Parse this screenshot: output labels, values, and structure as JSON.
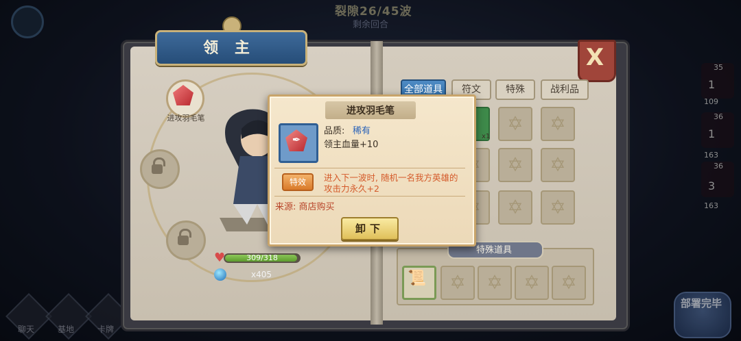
{
  "hud": {
    "wave": "裂隙26/45波",
    "sub": "剩余回合",
    "bottom_buttons": [
      "聊天",
      "基地",
      "卡牌"
    ],
    "deploy_label": "部署完毕",
    "side_numbers": [
      "35",
      "36",
      "36",
      "109",
      "163",
      "163",
      "1",
      "1",
      "3"
    ]
  },
  "panel": {
    "title": "领 主",
    "close_label": "X",
    "slot_label": "进攻羽毛笔",
    "hp": {
      "current": 309,
      "max": 318,
      "text": "309/318"
    },
    "gold": "x405",
    "tabs": [
      {
        "label": "全部道具",
        "active": true
      },
      {
        "label": "符文",
        "active": false
      },
      {
        "label": "特殊",
        "active": false
      },
      {
        "label": "战利品",
        "active": false
      }
    ],
    "item_qty": "x1",
    "special_title": "特殊道具"
  },
  "popup": {
    "title": "进攻羽毛笔",
    "quality_label": "品质:",
    "quality_value": "稀有",
    "stat": "领主血量+10",
    "effect_badge": "特效",
    "effect_text": "进入下一波时, 随机一名我方英雄的攻击力永久+2",
    "source": "来源: 商店购买",
    "unequip_button": "卸下"
  },
  "colors": {
    "tab_active": "#2d6aa4",
    "rarity": "#2b63b8",
    "effect": "#d45a2a",
    "source": "#b8452a",
    "hp_fill": "#5d9b2d",
    "close": "#a0453a"
  }
}
